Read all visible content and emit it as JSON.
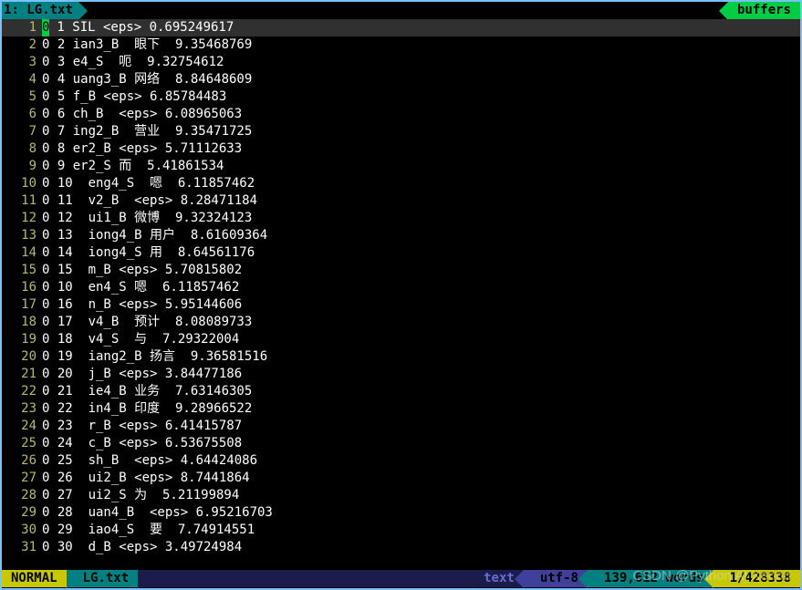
{
  "tab": {
    "index": "1",
    "name": "LG.txt",
    "right": "buffers"
  },
  "cursor_char": "0",
  "lines": [
    {
      "n": "1",
      "rest": " 1 SIL <eps> 0.695249617",
      "cursor": true
    },
    {
      "n": "2",
      "rest": "0 2 ian3_B  眼下  9.35468769"
    },
    {
      "n": "3",
      "rest": "0 3 e4_S  呃  9.32754612"
    },
    {
      "n": "4",
      "rest": "0 4 uang3_B 网络  8.84648609"
    },
    {
      "n": "5",
      "rest": "0 5 f_B <eps> 6.85784483"
    },
    {
      "n": "6",
      "rest": "0 6 ch_B  <eps> 6.08965063"
    },
    {
      "n": "7",
      "rest": "0 7 ing2_B  营业  9.35471725"
    },
    {
      "n": "8",
      "rest": "0 8 er2_B <eps> 5.71112633"
    },
    {
      "n": "9",
      "rest": "0 9 er2_S 而  5.41861534"
    },
    {
      "n": "10",
      "rest": "0 10  eng4_S  嗯  6.11857462"
    },
    {
      "n": "11",
      "rest": "0 11  v2_B  <eps> 8.28471184"
    },
    {
      "n": "12",
      "rest": "0 12  ui1_B 微博  9.32324123"
    },
    {
      "n": "13",
      "rest": "0 13  iong4_B 用户  8.61609364"
    },
    {
      "n": "14",
      "rest": "0 14  iong4_S 用  8.64561176"
    },
    {
      "n": "15",
      "rest": "0 15  m_B <eps> 5.70815802"
    },
    {
      "n": "16",
      "rest": "0 10  en4_S 嗯  6.11857462"
    },
    {
      "n": "17",
      "rest": "0 16  n_B <eps> 5.95144606"
    },
    {
      "n": "18",
      "rest": "0 17  v4_B  预计  8.08089733"
    },
    {
      "n": "19",
      "rest": "0 18  v4_S  与  7.29322004"
    },
    {
      "n": "20",
      "rest": "0 19  iang2_B 扬言  9.36581516"
    },
    {
      "n": "21",
      "rest": "0 20  j_B <eps> 3.84477186"
    },
    {
      "n": "22",
      "rest": "0 21  ie4_B 业务  7.63146305"
    },
    {
      "n": "23",
      "rest": "0 22  in4_B 印度  9.28966522"
    },
    {
      "n": "24",
      "rest": "0 23  r_B <eps> 6.41415787"
    },
    {
      "n": "25",
      "rest": "0 24  c_B <eps> 6.53675508"
    },
    {
      "n": "26",
      "rest": "0 25  sh_B  <eps> 4.64424086"
    },
    {
      "n": "27",
      "rest": "0 26  ui2_B <eps> 8.7441864"
    },
    {
      "n": "28",
      "rest": "0 27  ui2_S 为  5.21199894"
    },
    {
      "n": "29",
      "rest": "0 28  uan4_B  <eps> 6.95216703"
    },
    {
      "n": "30",
      "rest": "0 29  iao4_S  要  7.74914551"
    },
    {
      "n": "31",
      "rest": "0 30  d_B <eps> 3.49724984"
    }
  ],
  "status": {
    "mode": "NORMAL",
    "file": "LG.txt",
    "filetype": "text",
    "encoding": "utf-8",
    "words": "139,612 words",
    "position": "1/428338"
  },
  "watermark": "CSDN @Python AI Xenon"
}
